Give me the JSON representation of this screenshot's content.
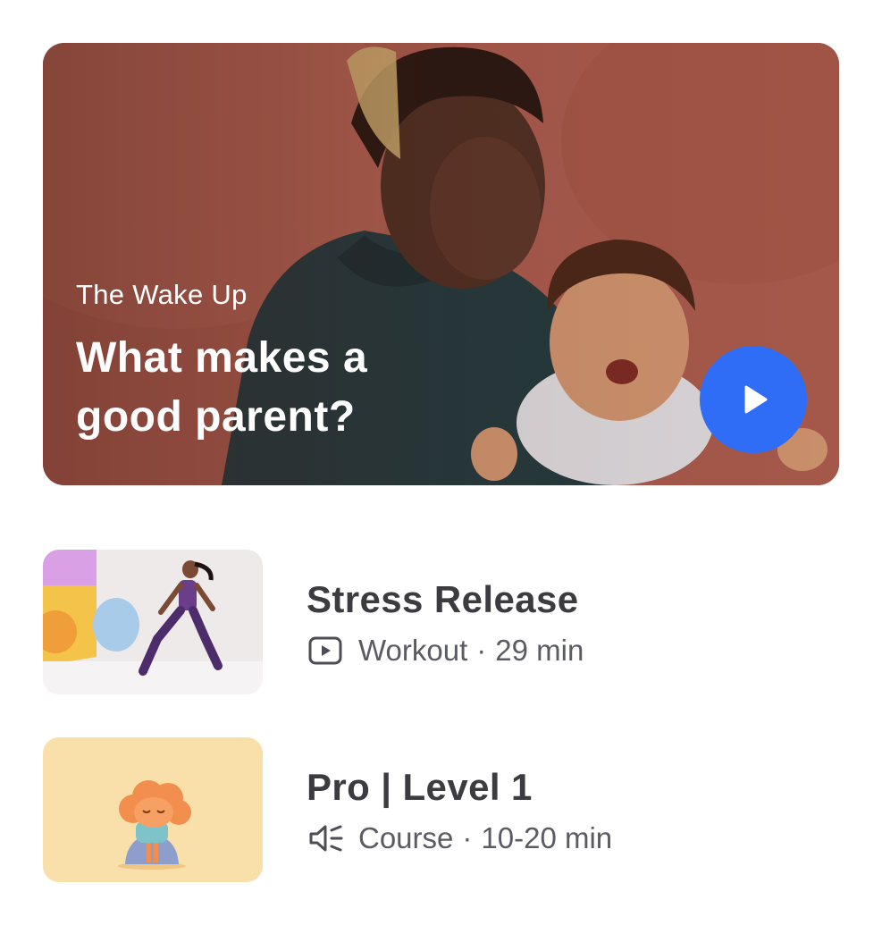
{
  "hero": {
    "eyebrow": "The Wake Up",
    "title": "What makes a good parent?",
    "play_icon": "play-icon",
    "accent_color": "#2f6df6",
    "background_color": "#a4584a"
  },
  "items": [
    {
      "title": "Stress Release",
      "icon": "video-icon",
      "type": "Workout",
      "separator": "·",
      "duration": "29 min"
    },
    {
      "title": "Pro | Level 1",
      "icon": "audio-icon",
      "type": "Course",
      "separator": "·",
      "duration": "10-20 min"
    }
  ]
}
